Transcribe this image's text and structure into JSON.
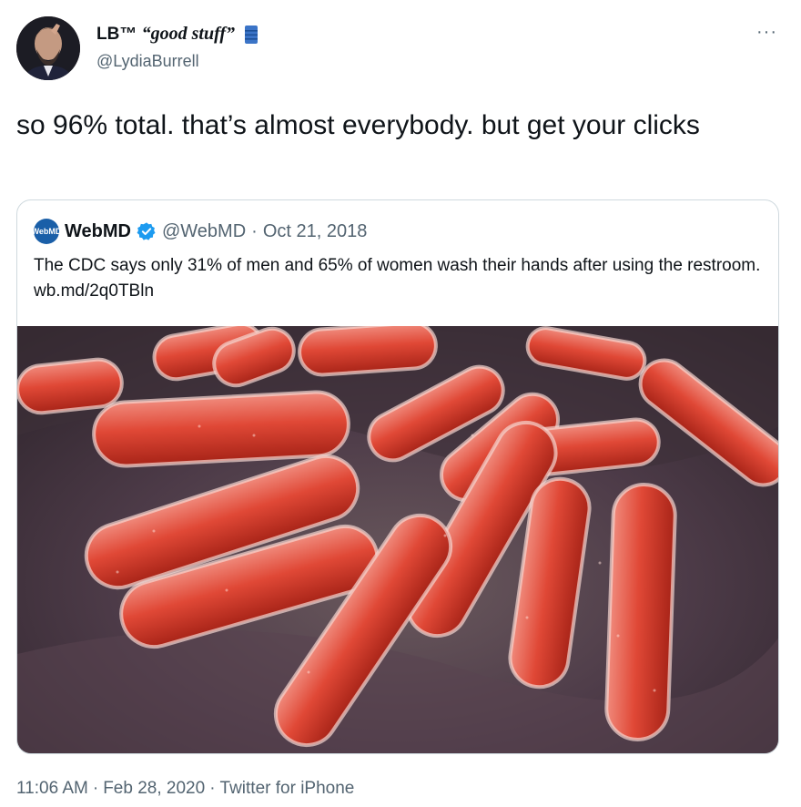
{
  "author": {
    "name_prefix": "LB™ ",
    "name_quote": "“good stuff”",
    "handle": "@LydiaBurrell",
    "avatar_icon": "avatar-photo",
    "flag_icon": "blue-barrel-icon"
  },
  "menu": {
    "more_label": "···"
  },
  "tweet": {
    "text": "so 96% total. that’s almost everybody. but get your clicks"
  },
  "quoted": {
    "logo_text": "WebMD",
    "name": "WebMD",
    "verified_icon": "verified-badge-icon",
    "handle": "@WebMD",
    "separator": "·",
    "date": "Oct 21, 2018",
    "text": "The CDC says only 31% of men and 65% of women wash their hands after using the restroom. wb.md/2q0TBln",
    "media_description_icon": "bacteria-image"
  },
  "footer": {
    "time": "11:06 AM",
    "sep1": "·",
    "date": "Feb 28, 2020",
    "sep2": "·",
    "source": "Twitter for iPhone"
  },
  "colors": {
    "text": "#0f1419",
    "secondary": "#536471",
    "border": "#cfd9de",
    "verified": "#1d9bf0"
  }
}
